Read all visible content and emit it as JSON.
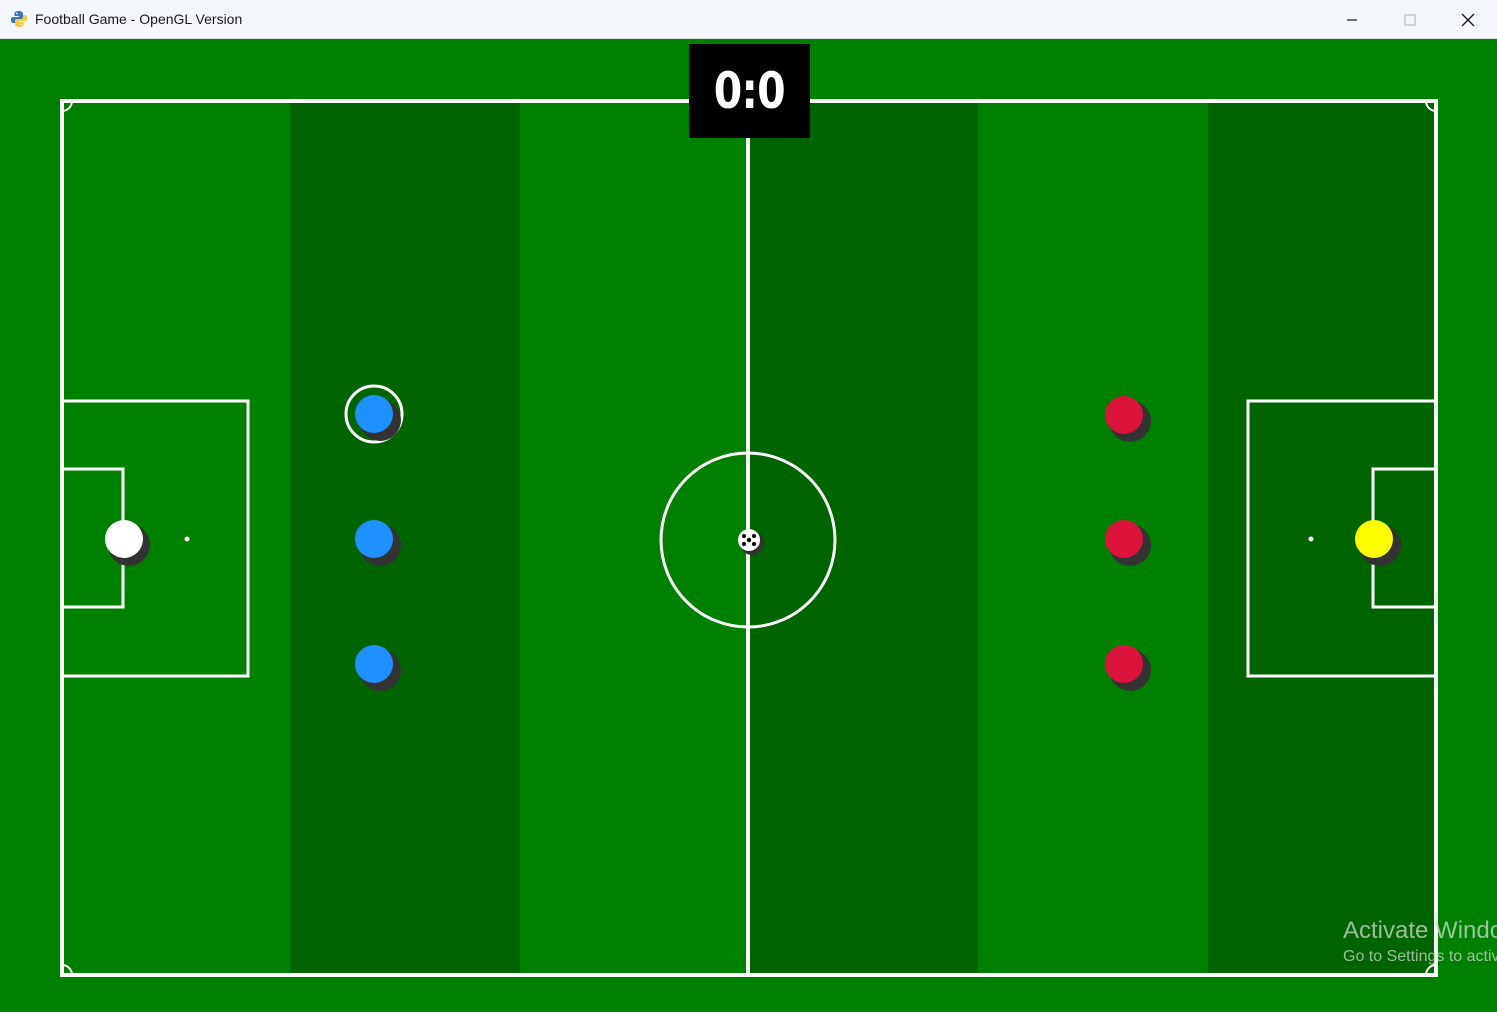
{
  "window": {
    "title": "Football Game - OpenGL Version",
    "icon": "python-icon",
    "controls": {
      "minimize": "minimize-icon",
      "maximize": "maximize-icon",
      "close": "close-icon"
    }
  },
  "scoreboard": {
    "score": "0:0"
  },
  "colors": {
    "background": "#008000",
    "stripe_light": "#008000",
    "stripe_dark": "#006400",
    "lines": "#ffffff",
    "team_left": "#1e90ff",
    "team_right": "#dc143c",
    "keeper_left": "#ffffff",
    "keeper_right": "#ffff00",
    "shadow": "#333333"
  },
  "players": [
    {
      "team": "left",
      "role": "keeper",
      "color": "#ffffff",
      "selected": false
    },
    {
      "team": "left",
      "role": "player",
      "color": "#1e90ff",
      "selected": true
    },
    {
      "team": "left",
      "role": "player",
      "color": "#1e90ff",
      "selected": false
    },
    {
      "team": "left",
      "role": "player",
      "color": "#1e90ff",
      "selected": false
    },
    {
      "team": "right",
      "role": "player",
      "color": "#dc143c",
      "selected": false
    },
    {
      "team": "right",
      "role": "player",
      "color": "#dc143c",
      "selected": false
    },
    {
      "team": "right",
      "role": "player",
      "color": "#dc143c",
      "selected": false
    },
    {
      "team": "right",
      "role": "keeper",
      "color": "#ffff00",
      "selected": false
    }
  ],
  "ball": {
    "icon": "soccer-ball-icon"
  },
  "watermark": {
    "title": "Activate Windows",
    "subtitle": "Go to Settings to activate Windows."
  }
}
